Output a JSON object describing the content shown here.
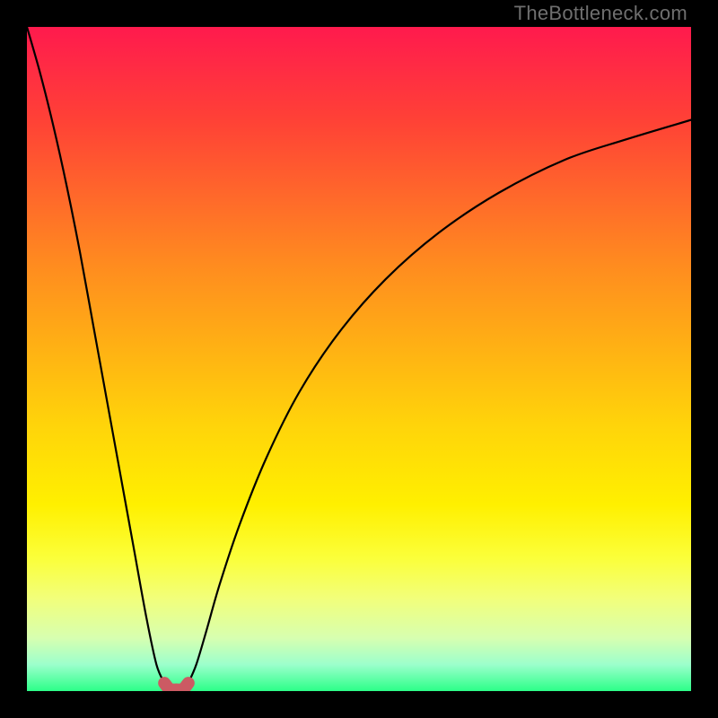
{
  "watermark": {
    "text": "TheBottleneck.com"
  },
  "colors": {
    "frame": "#000000",
    "curve": "#000000",
    "marker": "#cc5a63",
    "gradient_top": "#ff1a4d",
    "gradient_bottom": "#2cff88"
  },
  "chart_data": {
    "type": "line",
    "title": "",
    "xlabel": "",
    "ylabel": "",
    "xlim": [
      0,
      100
    ],
    "ylim": [
      0,
      100
    ],
    "grid": false,
    "legend_position": "none",
    "annotations": [
      "TheBottleneck.com"
    ],
    "series": [
      {
        "name": "left-branch",
        "x": [
          0,
          2,
          4,
          6,
          8,
          10,
          12,
          14,
          16,
          18,
          19.5,
          20.7
        ],
        "y": [
          100,
          93,
          85,
          76,
          66,
          55,
          44,
          33,
          22,
          11,
          4,
          1.2
        ]
      },
      {
        "name": "right-branch",
        "x": [
          24.3,
          25.5,
          27,
          29,
          32,
          36,
          41,
          47,
          54,
          62,
          71,
          81,
          90,
          100
        ],
        "y": [
          1.2,
          4,
          9,
          16,
          25,
          35,
          45,
          54,
          62,
          69,
          75,
          80,
          83,
          86
        ]
      },
      {
        "name": "trough-marker",
        "x": [
          20.7,
          21.5,
          22.5,
          23.5,
          24.3
        ],
        "y": [
          1.2,
          0.3,
          0.2,
          0.3,
          1.2
        ]
      }
    ],
    "notes": "Values are percentages of the plot area; (0,0) is bottom-left of the colored square. Curve resembles a bottleneck (V-shape) with minimum near x≈22. Background is a vertical red→yellow→green gradient encoding the y-axis (high=red, low=green)."
  }
}
